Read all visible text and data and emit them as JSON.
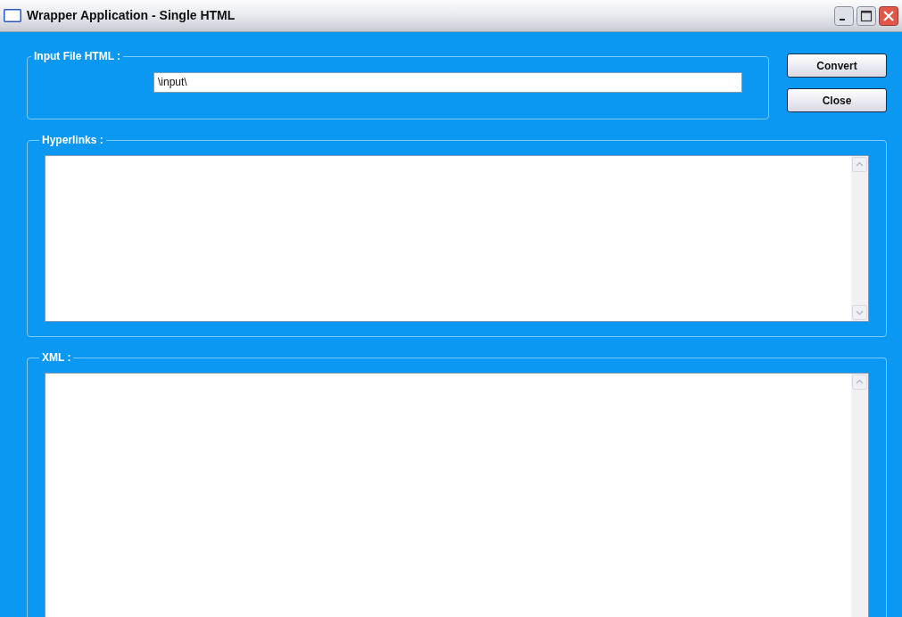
{
  "window": {
    "title": "Wrapper Application - Single HTML"
  },
  "input_group": {
    "legend": "Input File HTML :",
    "value": "\\input\\"
  },
  "buttons": [
    "Convert",
    "Close"
  ],
  "hyperlinks_group": {
    "legend": "Hyperlinks :"
  },
  "xml_group": {
    "legend": "XML :"
  }
}
